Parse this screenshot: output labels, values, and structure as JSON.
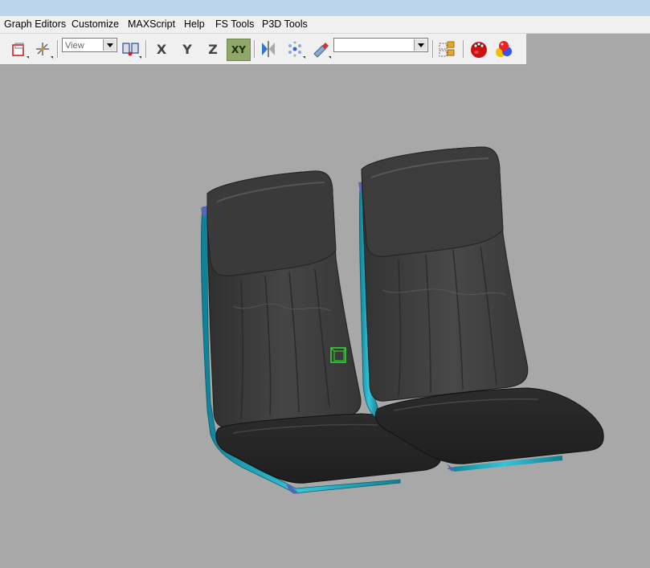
{
  "menubar": {
    "items": [
      "Graph Editors",
      "Customize",
      "MAXScript",
      "Help",
      "FS Tools",
      "P3D Tools"
    ]
  },
  "toolbar": {
    "view_dropdown": "View",
    "axis_x": "X",
    "axis_y": "Y",
    "axis_z": "Z",
    "axis_xy": "XY",
    "selection_set_value": ""
  },
  "colors": {
    "viewport_bg": "#a8a8a8",
    "seat_fabric": "#3c3c3c",
    "seat_frame": "#1ea3b8",
    "helper_box": "#33dd33"
  },
  "icons": [
    "select-region-icon",
    "transform-gizmo-icon",
    "pivot-icon",
    "mirror-icon",
    "align-icon",
    "named-selection-icon",
    "layer-manager-icon",
    "render-teapot-icon",
    "material-editor-icon"
  ]
}
